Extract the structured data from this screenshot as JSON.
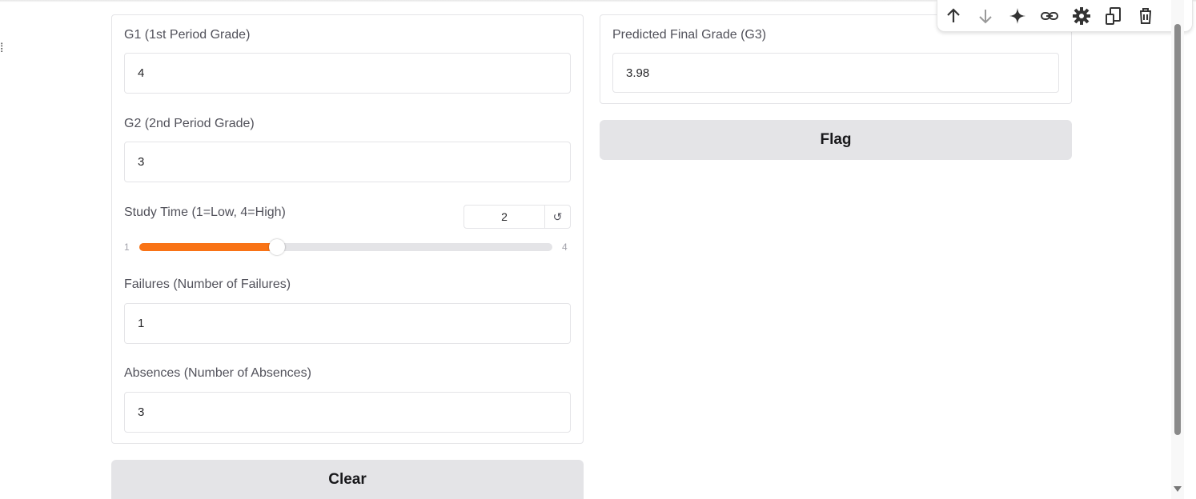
{
  "inputs_panel": {
    "g1": {
      "label": "G1 (1st Period Grade)",
      "value": "4"
    },
    "g2": {
      "label": "G2 (2nd Period Grade)",
      "value": "3"
    },
    "study_time": {
      "label": "Study Time (1=Low, 4=High)",
      "value": "2",
      "min": "1",
      "max": "4",
      "fraction": 0.333,
      "reset_icon": "↺"
    },
    "failures": {
      "label": "Failures (Number of Failures)",
      "value": "1"
    },
    "absences": {
      "label": "Absences (Number of Absences)",
      "value": "3"
    }
  },
  "output_panel": {
    "label": "Predicted Final Grade (G3)",
    "value": "3.98"
  },
  "buttons": {
    "clear": "Clear",
    "flag": "Flag"
  },
  "toolbar": {
    "icons": [
      "arrow-up-icon",
      "arrow-down-icon",
      "sparkle-icon",
      "link-icon",
      "gear-icon",
      "transform-icon",
      "trash-icon",
      "more-vert-icon"
    ]
  },
  "colors": {
    "slider_fill": "#f97316",
    "button_bg": "#e4e4e7",
    "border": "#e4e4e7"
  }
}
